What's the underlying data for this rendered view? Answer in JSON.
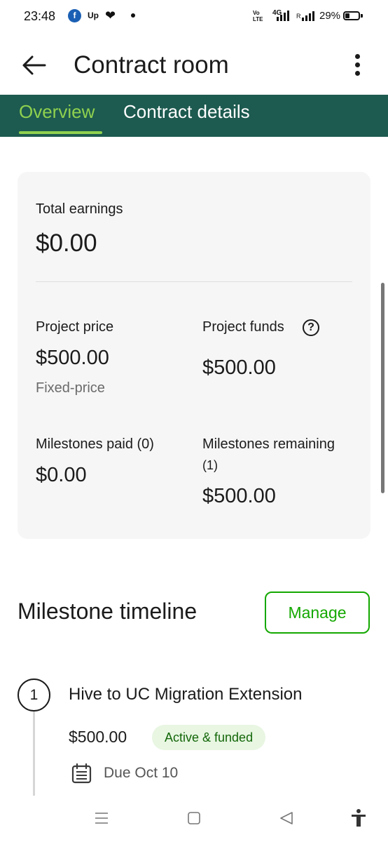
{
  "status_bar": {
    "time": "23:48",
    "notification_icons": [
      "facebook-icon",
      "upwork-icon",
      "heart-icon",
      "dot-icon"
    ],
    "volte_line1": "Vo",
    "volte_line2": "LTE",
    "network": "4G",
    "roaming": "R",
    "battery": "29%",
    "battery_level": 0.29
  },
  "app_bar": {
    "title": "Contract room",
    "back_icon": "arrow-left-icon",
    "more_icon": "more-vertical-icon"
  },
  "tabs": [
    {
      "label": "Overview",
      "active": true
    },
    {
      "label": "Contract details",
      "active": false
    }
  ],
  "colors": {
    "tab_bg": "#1d5a4f",
    "tab_active": "#8fd14f",
    "brand_green": "#14a800",
    "badge_bg": "#e8f6e2",
    "badge_text": "#14670a"
  },
  "summary": {
    "total_earnings_label": "Total earnings",
    "total_earnings_value": "$0.00",
    "project_price_label": "Project price",
    "project_price_value": "$500.00",
    "project_price_type": "Fixed-price",
    "project_funds_label": "Project funds",
    "project_funds_value": "$500.00",
    "help_icon_glyph": "?",
    "milestones_paid_label": "Milestones paid (0)",
    "milestones_paid_value": "$0.00",
    "milestones_remaining_label_line1": "Milestones remaining",
    "milestones_remaining_label_line2": "(1)",
    "milestones_remaining_value": "$500.00"
  },
  "milestones": {
    "title": "Milestone timeline",
    "manage_label": "Manage",
    "items": [
      {
        "number": "1",
        "name": "Hive to UC Migration Extension",
        "amount": "$500.00",
        "status": "Active & funded",
        "due": "Due Oct 10"
      }
    ]
  },
  "nav_bar": {
    "icons": [
      "menu-icon",
      "home-square-icon",
      "back-triangle-icon",
      "accessibility-icon"
    ]
  }
}
